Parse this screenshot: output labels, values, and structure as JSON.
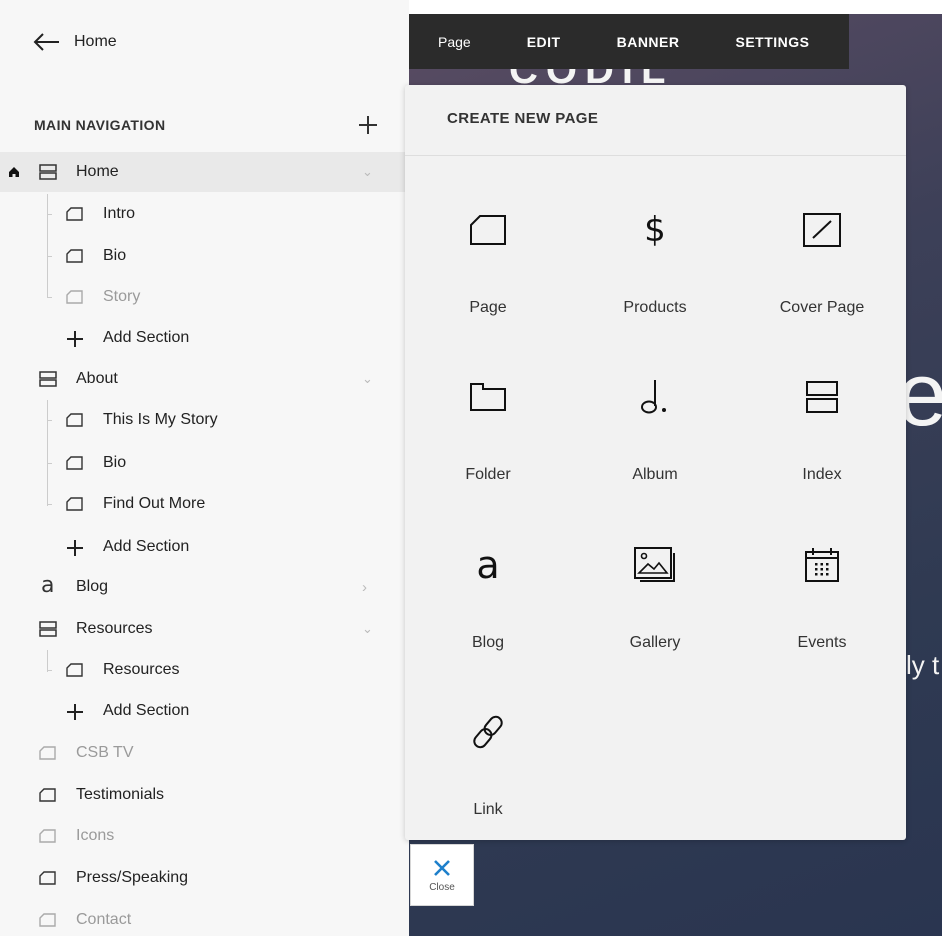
{
  "sidebar": {
    "back_label": "Home",
    "section_title": "MAIN NAVIGATION",
    "items": [
      {
        "label": "Home"
      },
      {
        "label": "Intro"
      },
      {
        "label": "Bio"
      },
      {
        "label": "Story"
      },
      {
        "label": "Add Section"
      },
      {
        "label": "About"
      },
      {
        "label": "This Is My Story"
      },
      {
        "label": "Bio"
      },
      {
        "label": "Find Out More"
      },
      {
        "label": "Add Section"
      },
      {
        "label": "Blog"
      },
      {
        "label": "Resources"
      },
      {
        "label": "Resources"
      },
      {
        "label": "Add Section"
      },
      {
        "label": "CSB TV"
      },
      {
        "label": "Testimonials"
      },
      {
        "label": "Icons"
      },
      {
        "label": "Press/Speaking"
      },
      {
        "label": "Contact"
      }
    ]
  },
  "topbar": {
    "tabs": [
      {
        "label": "Page"
      },
      {
        "label": "EDIT"
      },
      {
        "label": "BANNER"
      },
      {
        "label": "SETTINGS"
      }
    ]
  },
  "panel": {
    "title": "CREATE NEW PAGE",
    "types": [
      {
        "label": "Page",
        "icon": "page-icon"
      },
      {
        "label": "Products",
        "icon": "dollar-icon"
      },
      {
        "label": "Cover Page",
        "icon": "cover-page-icon"
      },
      {
        "label": "Folder",
        "icon": "folder-icon"
      },
      {
        "label": "Album",
        "icon": "music-note-icon"
      },
      {
        "label": "Index",
        "icon": "index-icon"
      },
      {
        "label": "Blog",
        "icon": "blog-icon"
      },
      {
        "label": "Gallery",
        "icon": "image-icon"
      },
      {
        "label": "Events",
        "icon": "calendar-icon"
      },
      {
        "label": "Link",
        "icon": "link-icon"
      }
    ]
  },
  "close": {
    "label": "Close"
  },
  "preview": {
    "text1": "CODIL",
    "text2": "e",
    "text3": "ly t"
  },
  "colors": {
    "accent": "#1e7fcb",
    "topbar": "#2b2b2b",
    "active_row": "#e9e9e9"
  }
}
